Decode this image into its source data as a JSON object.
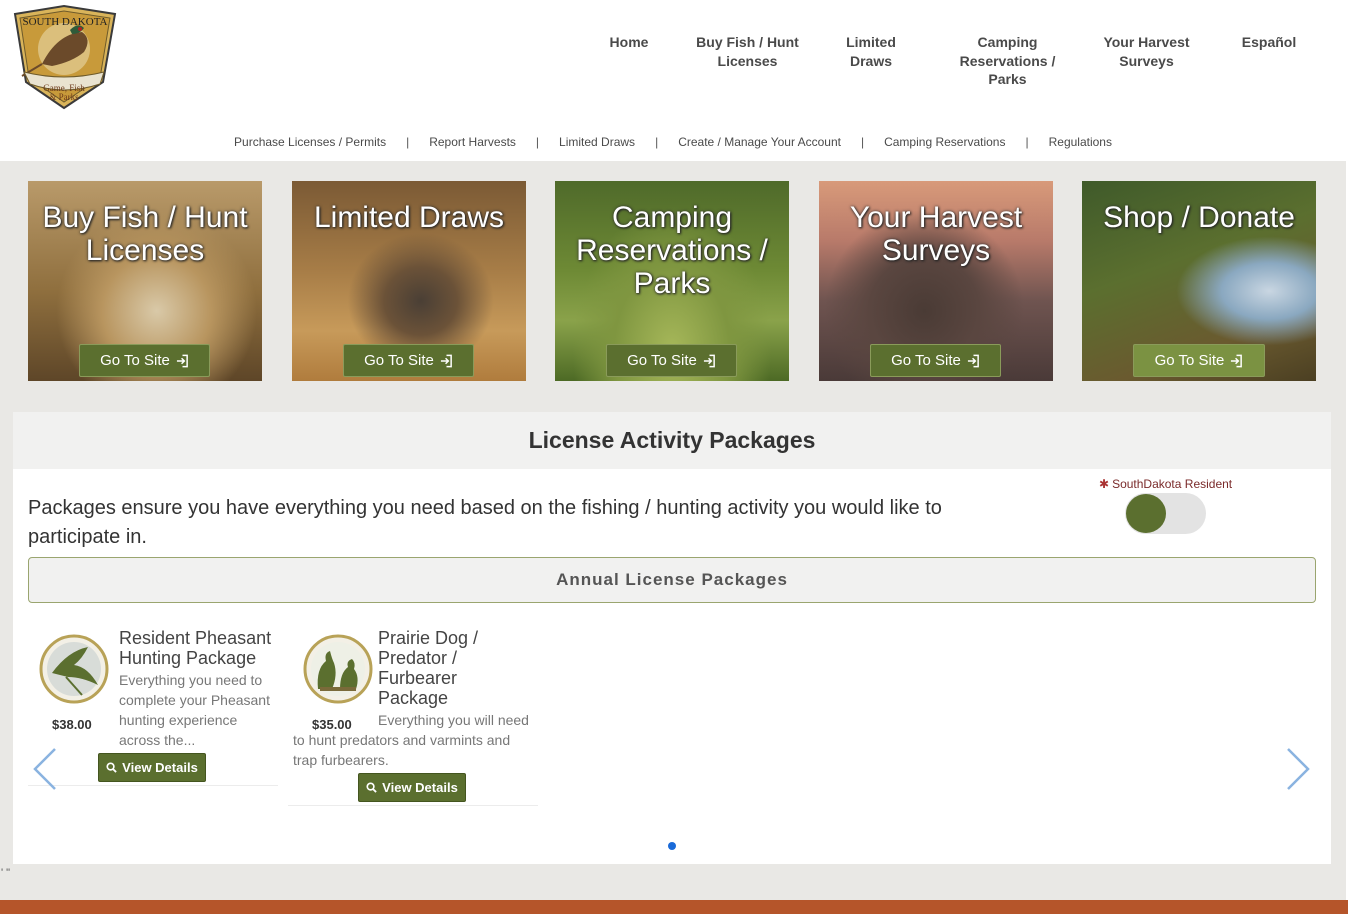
{
  "logo": {
    "top_text": "SOUTH DAKOTA",
    "bottom_text_1": "Game, Fish",
    "bottom_text_2": "& Parks"
  },
  "main_nav": [
    {
      "line1": "Home",
      "line2": "",
      "line3": ""
    },
    {
      "line1": "Buy Fish / Hunt",
      "line2": "Licenses",
      "line3": ""
    },
    {
      "line1": "Limited",
      "line2": "Draws",
      "line3": ""
    },
    {
      "line1": "Camping",
      "line2": "Reservations /",
      "line3": "Parks"
    },
    {
      "line1": "Your Harvest",
      "line2": "Surveys",
      "line3": ""
    },
    {
      "line1": "Español",
      "line2": "",
      "line3": ""
    }
  ],
  "sub_nav": [
    "Purchase Licenses / Permits",
    "Report Harvests",
    "Limited Draws",
    "Create / Manage Your Account",
    "Camping Reservations",
    "Regulations"
  ],
  "sub_nav_separator": "|",
  "tiles": [
    {
      "title": "Buy Fish / Hunt Licenses",
      "button": "Go To Site"
    },
    {
      "title": "Limited Draws",
      "button": "Go To Site"
    },
    {
      "title": "Camping Reservations / Parks",
      "button": "Go To Site"
    },
    {
      "title": "Your Harvest Surveys",
      "button": "Go To Site"
    },
    {
      "title": "Shop / Donate",
      "button": "Go To Site"
    }
  ],
  "packages": {
    "heading": "License Activity Packages",
    "description": "Packages ensure you have everything you need based on the fishing / hunting activity you would like to participate in.",
    "resident_label": "SouthDakota Resident",
    "resident_required_mark": "✱",
    "resident_toggle_on": true,
    "annual_heading": "Annual License Packages",
    "cards": [
      {
        "title": "Resident Pheasant Hunting Package",
        "price": "$38.00",
        "text": "Everything you need to complete your Pheasant hunting experience across the...",
        "button": "View Details"
      },
      {
        "title": "Prairie Dog / Predator / Furbearer Package",
        "price": "$35.00",
        "text": "Everything you will need to hunt predators and varmints and trap furbearers.",
        "button": "View Details"
      }
    ],
    "carousel_page_count": 1,
    "carousel_active_page": 1
  },
  "stray_text": "' \"",
  "colors": {
    "brand_green": "#5b6f2f",
    "carousel_dot": "#1a6ad8",
    "footer": "#b5552a",
    "resident_label": "#7a2a2a"
  },
  "icons": {
    "go_to_site": "sign-in-icon",
    "view_details": "search-icon",
    "carousel_prev": "chevron-left-icon",
    "carousel_next": "chevron-right-icon"
  }
}
